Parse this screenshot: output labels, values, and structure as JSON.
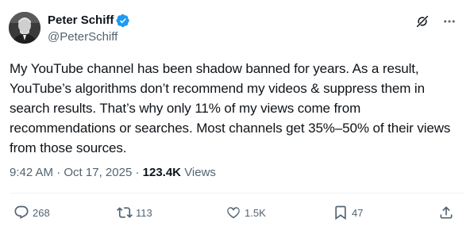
{
  "author": {
    "display_name": "Peter Schiff",
    "handle": "@PeterSchiff",
    "verified": true
  },
  "tweet": {
    "text": "My YouTube channel has been shadow banned for years. As a result, YouTube’s algorithms don’t recommend my videos & suppress them in search results. That’s why only 11% of my views come from recommendations or searches. Most channels get 35%–50% of their views from those sources.",
    "time": "9:42 AM",
    "date": "Oct 17, 2025",
    "separator": "·",
    "views_count": "123.4K",
    "views_label": "Views"
  },
  "engagement": {
    "replies": "268",
    "reposts": "113",
    "likes": "1.5K",
    "bookmarks": "47"
  },
  "icons": {
    "verified": "verified-badge-icon",
    "grok": "grok-icon",
    "more": "more-horizontal-icon",
    "reply": "reply-icon",
    "repost": "repost-icon",
    "like": "heart-icon",
    "bookmark": "bookmark-icon",
    "share": "share-icon"
  },
  "colors": {
    "text_primary": "#0f1419",
    "text_secondary": "#536471",
    "verified": "#1d9bf0",
    "divider": "#eff3f4"
  }
}
